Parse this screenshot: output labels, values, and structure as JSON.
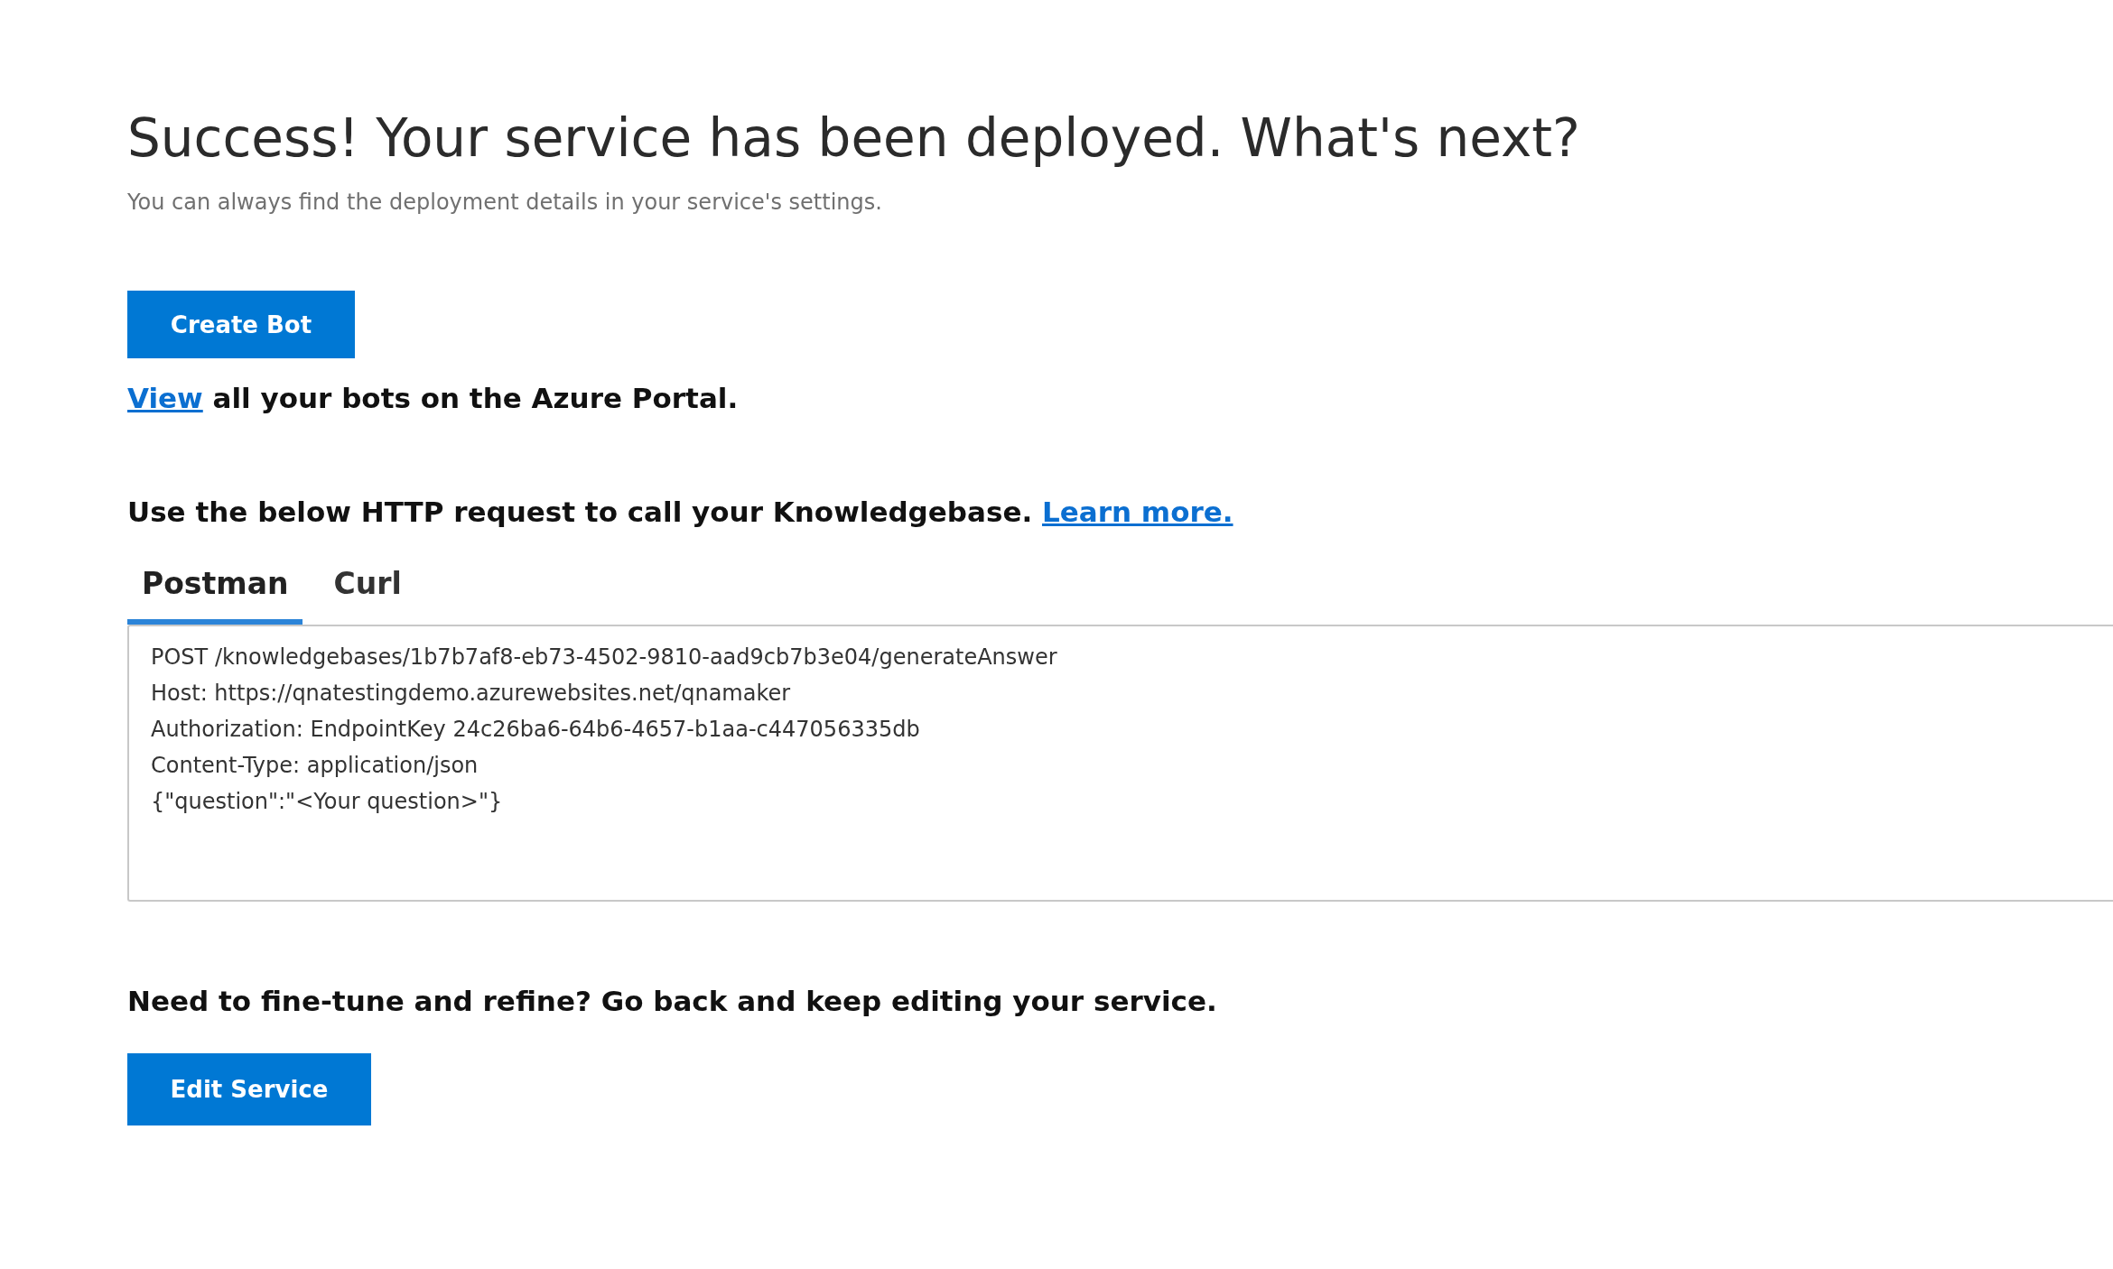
{
  "heading": "Success! Your service has been deployed. What's next?",
  "subheading": "You can always find the deployment details in your service's settings.",
  "create_button": "Create Bot",
  "view_line": {
    "link": "View",
    "text": "all your bots on the Azure Portal."
  },
  "request_line": {
    "text": "Use the below HTTP request to call your Knowledgebase.",
    "link": "Learn more."
  },
  "tabs": [
    {
      "label": "Postman",
      "selected": true
    },
    {
      "label": "Curl",
      "selected": false
    }
  ],
  "code_lines": [
    "POST /knowledgebases/1b7b7af8-eb73-4502-9810-aad9cb7b3e04/generateAnswer",
    "Host: https://qnatestingdemo.azurewebsites.net/qnamaker",
    "Authorization: EndpointKey 24c26ba6-64b6-4657-b1aa-c447056335db",
    "Content-Type: application/json",
    "{\"question\":\"<Your question>\"}"
  ],
  "edit_line": "Need to fine-tune and refine? Go back and keep editing your service.",
  "edit_button": "Edit Service"
}
